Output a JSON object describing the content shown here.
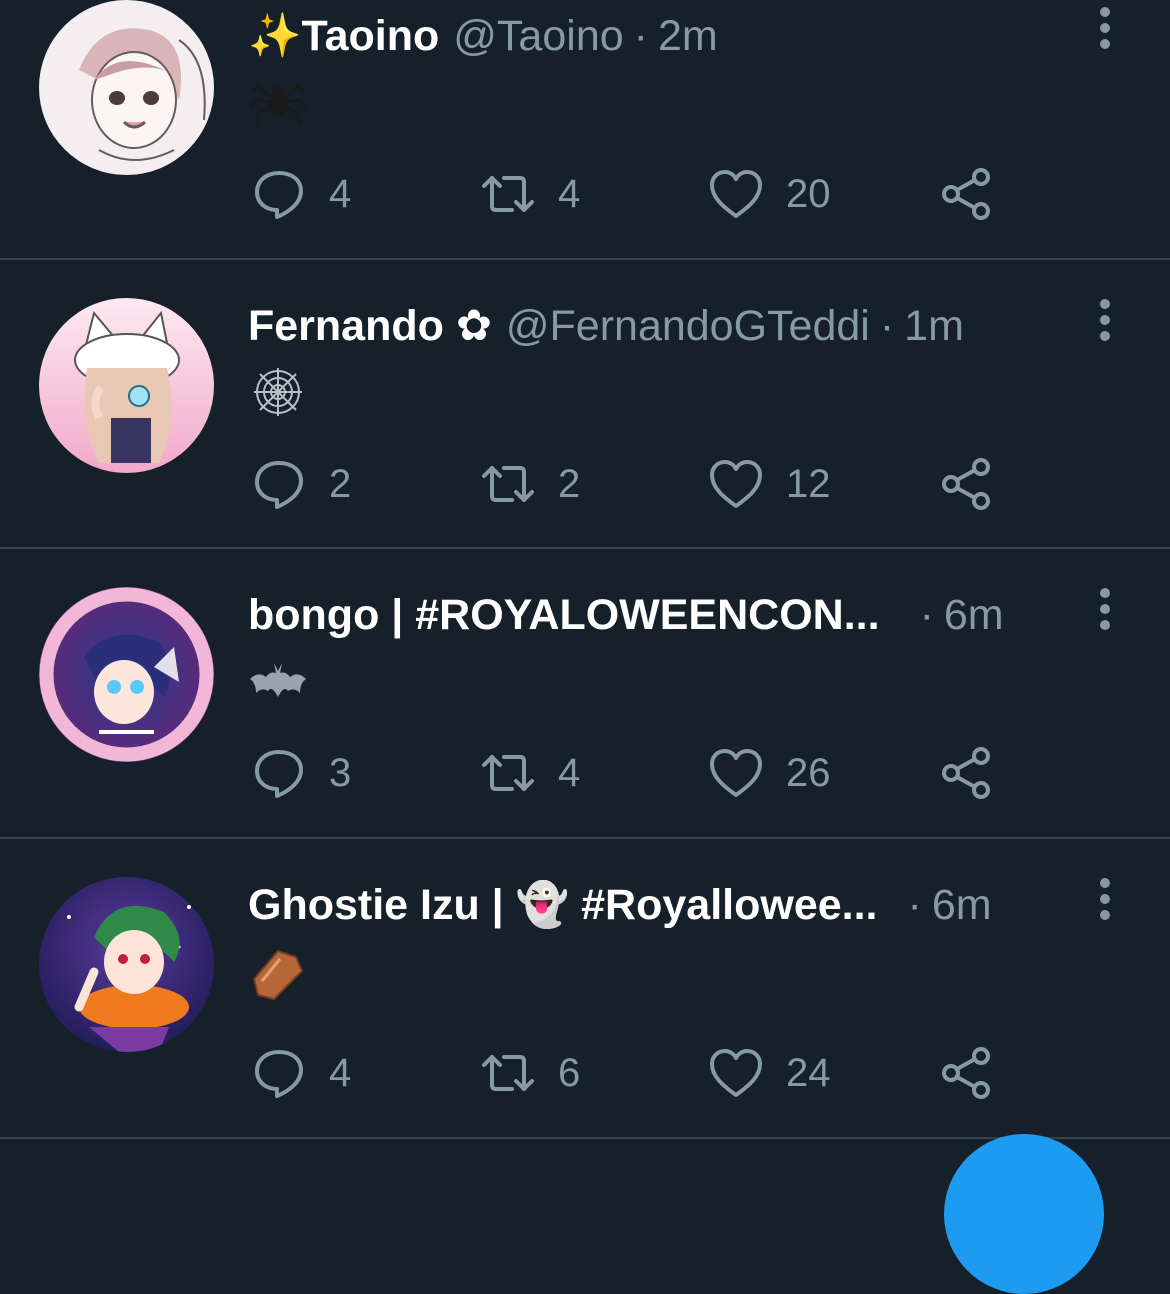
{
  "tweets": [
    {
      "display_name": "✨Taoino",
      "handle": "@Taoino",
      "separator": "·",
      "time": "2m",
      "body_emoji": "spider-emoji",
      "replies": "4",
      "retweets": "4",
      "likes": "20"
    },
    {
      "display_name": "Fernando ✿",
      "handle": "@FernandoGTeddi",
      "separator": "·",
      "time": "1m",
      "body_emoji": "spider-web-emoji",
      "replies": "2",
      "retweets": "2",
      "likes": "12"
    },
    {
      "display_name": "bongo | #ROYALOWEENCON...",
      "handle": "",
      "separator": "·",
      "time": "6m",
      "body_emoji": "bat-emoji",
      "replies": "3",
      "retweets": "4",
      "likes": "26"
    },
    {
      "display_name": "Ghostie Izu | 👻 #Royallowee...",
      "handle": "",
      "separator": "·",
      "time": "6m",
      "body_emoji": "coffin-emoji",
      "replies": "4",
      "retweets": "6",
      "likes": "24"
    }
  ],
  "colors": {
    "background": "#15202b",
    "divider": "#38444d",
    "secondary_text": "#8899a6",
    "accent": "#1d9bf0"
  }
}
